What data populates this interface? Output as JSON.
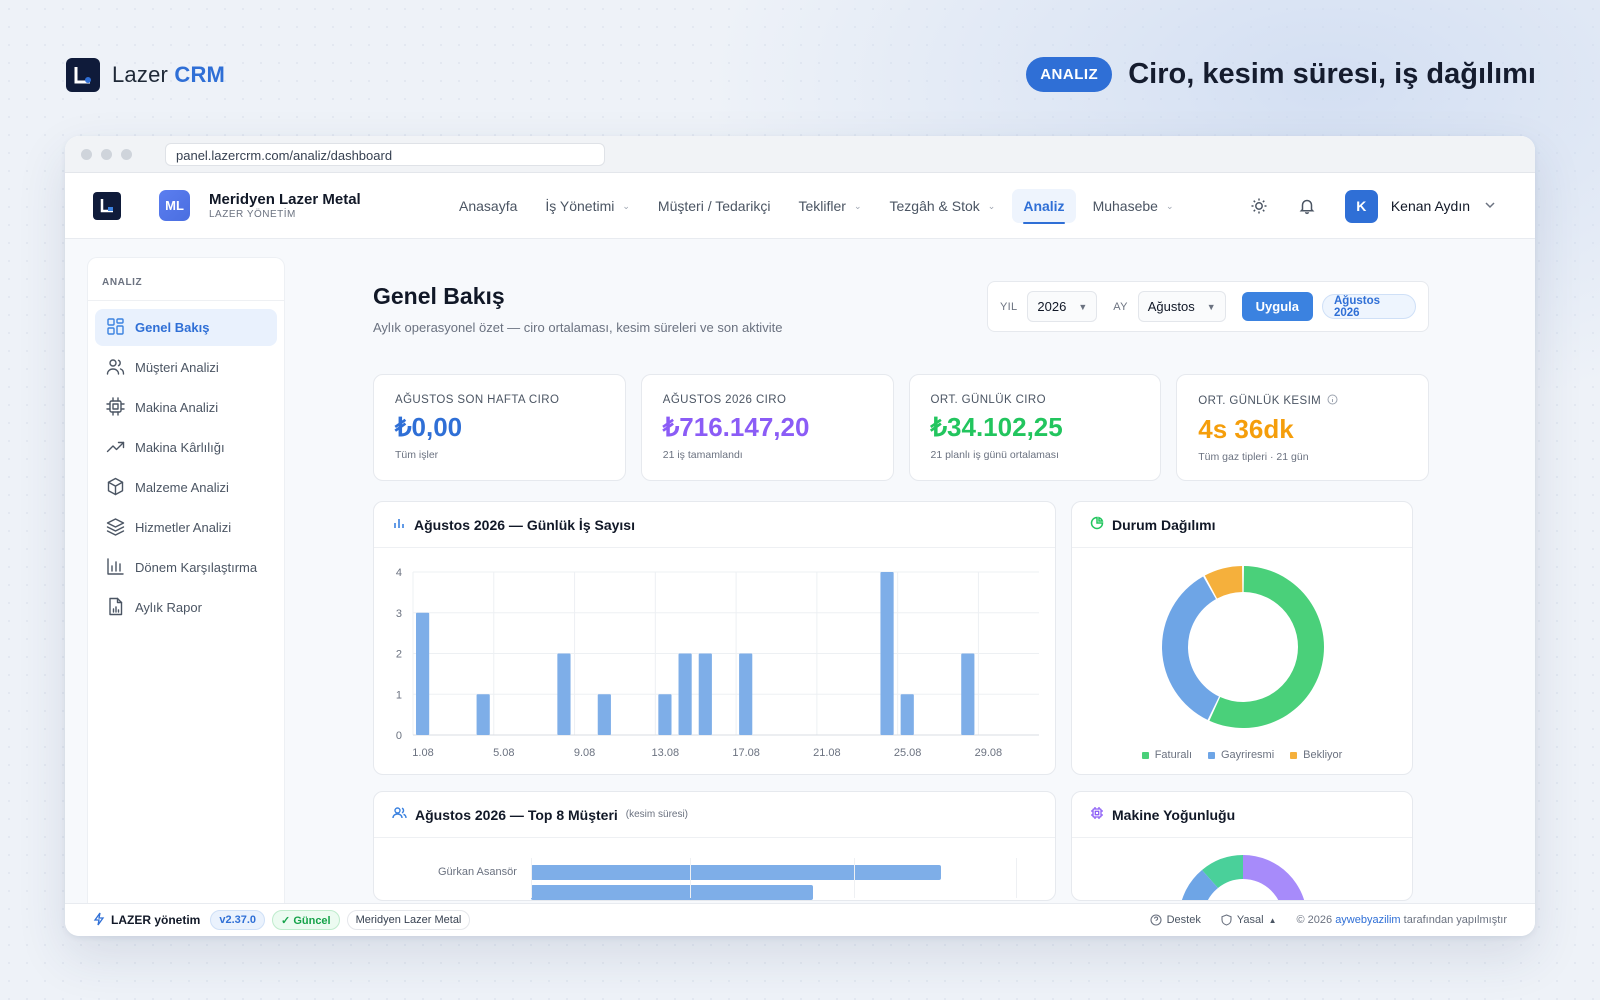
{
  "brand": {
    "name_prefix": "Lazer",
    "name_suffix": "CRM"
  },
  "hero": {
    "badge": "ANALIZ",
    "title": "Ciro, kesim süresi, iş dağılımı"
  },
  "browser": {
    "url": "panel.lazercrm.com/analiz/dashboard"
  },
  "org": {
    "avatar": "ML",
    "name": "Meridyen Lazer Metal",
    "sub": "LAZER YÖNETİM"
  },
  "nav": {
    "items": [
      {
        "label": "Anasayfa",
        "chevron": false
      },
      {
        "label": "İş Yönetimi",
        "chevron": true
      },
      {
        "label": "Müşteri / Tedarikçi",
        "chevron": false
      },
      {
        "label": "Teklifler",
        "chevron": true
      },
      {
        "label": "Tezgâh & Stok",
        "chevron": true
      },
      {
        "label": "Analiz",
        "chevron": false,
        "active": true
      },
      {
        "label": "Muhasebe",
        "chevron": true
      }
    ]
  },
  "user": {
    "avatar": "K",
    "name": "Kenan Aydın"
  },
  "sidebar": {
    "heading": "ANALIZ",
    "items": [
      {
        "label": "Genel Bakış",
        "icon": "grid-icon",
        "active": true
      },
      {
        "label": "Müşteri Analizi",
        "icon": "users-icon"
      },
      {
        "label": "Makina Analizi",
        "icon": "cpu-icon"
      },
      {
        "label": "Makina Kârlılığı",
        "icon": "trending-up-icon"
      },
      {
        "label": "Malzeme Analizi",
        "icon": "box-icon"
      },
      {
        "label": "Hizmetler Analizi",
        "icon": "layers-icon"
      },
      {
        "label": "Dönem Karşılaştırma",
        "icon": "bar-chart-icon"
      },
      {
        "label": "Aylık Rapor",
        "icon": "file-chart-icon"
      }
    ]
  },
  "page": {
    "title": "Genel Bakış",
    "subtitle": "Aylık operasyonel özet — ciro ortalaması, kesim süreleri ve son aktivite"
  },
  "filter": {
    "year_label": "YIL",
    "year": "2026",
    "month_label": "AY",
    "month": "Ağustos",
    "apply": "Uygula",
    "period": "Ağustos 2026"
  },
  "kpis": [
    {
      "label": "AĞUSTOS SON HAFTA CIRO",
      "value": "₺0,00",
      "sub": "Tüm işler",
      "color": "#2f6fd6"
    },
    {
      "label": "AĞUSTOS 2026 CIRO",
      "value": "₺716.147,20",
      "sub": "21 iş tamamlandı",
      "color": "#8b5cf6"
    },
    {
      "label": "ORT. GÜNLÜK CIRO",
      "value": "₺34.102,25",
      "sub": "21 planlı iş günü ortalaması",
      "color": "#22c55e"
    },
    {
      "label": "ORT. GÜNLÜK KESIM",
      "value": "4s 36dk",
      "sub": "Tüm gaz tipleri · 21 gün",
      "color": "#f59e0b"
    }
  ],
  "daily_chart": {
    "title": "Ağustos 2026 — Günlük İş Sayısı",
    "chart_data": {
      "type": "bar",
      "x": [
        1,
        2,
        3,
        4,
        5,
        6,
        7,
        8,
        9,
        10,
        11,
        12,
        13,
        14,
        15,
        16,
        17,
        18,
        19,
        20,
        21,
        22,
        23,
        24,
        25,
        26,
        27,
        28,
        29,
        30,
        31
      ],
      "values": [
        3,
        0,
        0,
        1,
        0,
        0,
        0,
        2,
        0,
        1,
        0,
        0,
        1,
        2,
        2,
        0,
        2,
        0,
        0,
        0,
        0,
        0,
        0,
        4,
        1,
        0,
        0,
        2,
        0,
        0,
        0
      ],
      "x_tick_labels": [
        "1.08",
        "5.08",
        "9.08",
        "13.08",
        "17.08",
        "21.08",
        "25.08",
        "29.08"
      ],
      "y_ticks": [
        0,
        1,
        2,
        3,
        4
      ],
      "ylim": [
        0,
        4
      ],
      "color": "#7eaee8"
    }
  },
  "status_chart": {
    "title": "Durum Dağılımı",
    "chart_data": {
      "type": "pie",
      "labels": [
        "Faturalı",
        "Gayriresmi",
        "Bekliyor"
      ],
      "values": [
        57,
        35,
        8
      ],
      "colors": [
        "#4ad07a",
        "#6ea5e6",
        "#f5b03c"
      ]
    }
  },
  "top_customers": {
    "title": "Ağustos 2026 — Top 8 Müşteri",
    "note": "(kesim süresi)",
    "first_customer": "Gürkan Asansör"
  },
  "machine_density": {
    "title": "Makine Yoğunluğu"
  },
  "footer": {
    "brand": "LAZER yönetim",
    "version": "v2.37.0",
    "status": "✓ Güncel",
    "org": "Meridyen Lazer Metal",
    "support": "Destek",
    "legal": "Yasal",
    "copyright_pre": "© 2026",
    "copyright_link": "aywebyazilim",
    "copyright_post": "tarafından yapılmıştır"
  }
}
